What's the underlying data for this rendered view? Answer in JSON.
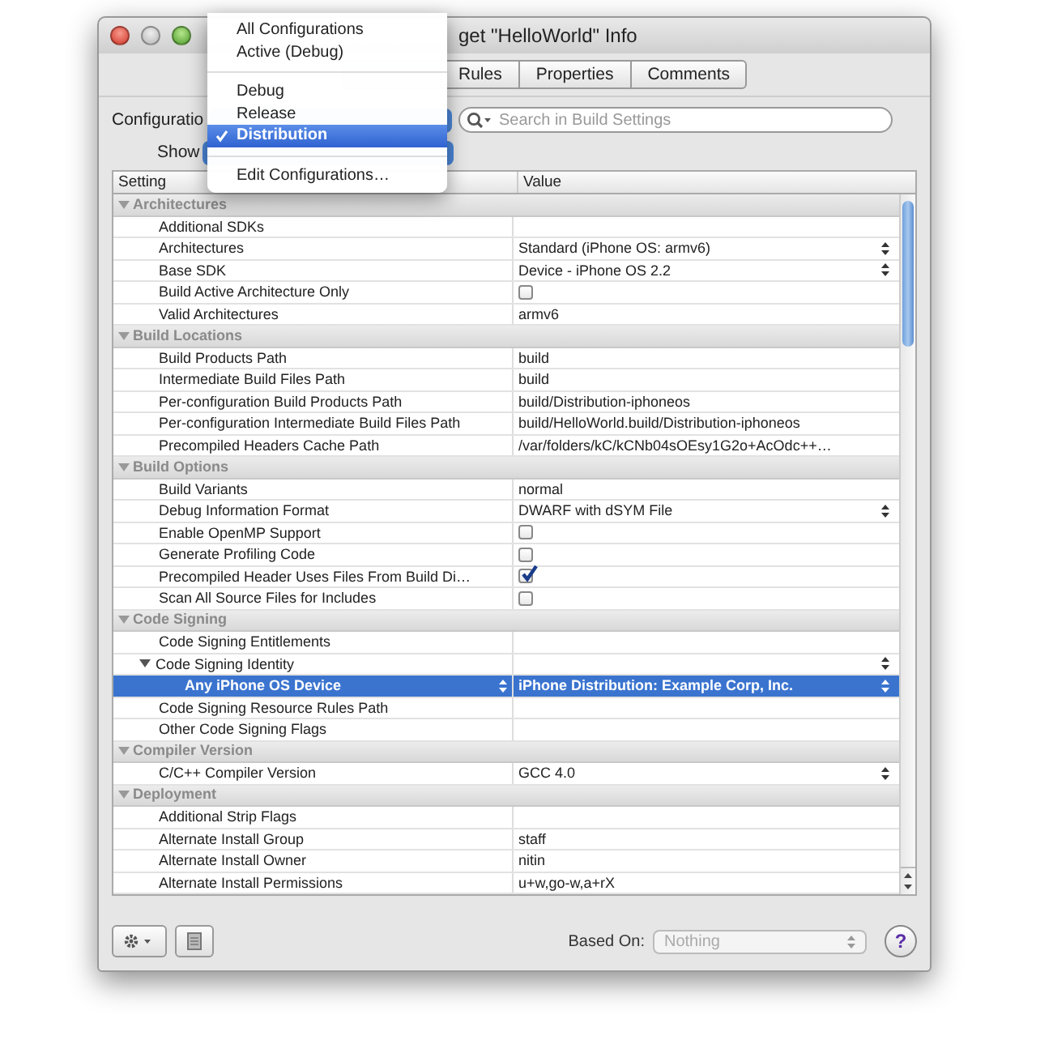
{
  "window": {
    "title": "get \"HelloWorld\" Info"
  },
  "tabs": [
    {
      "label": "Rules",
      "selected": false
    },
    {
      "label": "Properties",
      "selected": false
    },
    {
      "label": "Comments",
      "selected": false
    }
  ],
  "configuration": {
    "label": "Configuratio"
  },
  "show": {
    "label": "Show"
  },
  "search": {
    "placeholder": "Search in Build Settings"
  },
  "menu": {
    "sections": [
      [
        {
          "label": "All Configurations",
          "selected": false
        },
        {
          "label": "Active (Debug)",
          "selected": false
        }
      ],
      [
        {
          "label": "Debug",
          "selected": false
        },
        {
          "label": "Release",
          "selected": false
        },
        {
          "label": "Distribution",
          "selected": true
        }
      ],
      [
        {
          "label": "Edit Configurations…",
          "selected": false
        }
      ]
    ]
  },
  "table": {
    "columns": [
      "Setting",
      "Value"
    ],
    "groups": [
      {
        "label": "Architectures",
        "expanded": true,
        "children": [
          {
            "name": "Additional SDKs",
            "kind": "text",
            "selected": false
          },
          {
            "name": "Architectures",
            "kind": "popup",
            "value": "Standard (iPhone OS: armv6)",
            "selected": false
          },
          {
            "name": "Base SDK",
            "kind": "popup",
            "value": "Device - iPhone OS 2.2",
            "selected": false
          },
          {
            "name": "Build Active Architecture Only",
            "kind": "checkbox",
            "checked": false,
            "selected": false
          },
          {
            "name": "Valid Architectures",
            "kind": "text",
            "value": "armv6",
            "selected": false
          }
        ]
      },
      {
        "label": "Build Locations",
        "expanded": true,
        "children": [
          {
            "name": "Build Products Path",
            "kind": "text",
            "value": "build",
            "selected": false
          },
          {
            "name": "Intermediate Build Files Path",
            "kind": "text",
            "value": "build",
            "selected": false
          },
          {
            "name": "Per-configuration Build Products Path",
            "kind": "text",
            "value": "build/Distribution-iphoneos",
            "selected": false
          },
          {
            "name": "Per-configuration Intermediate Build Files Path",
            "kind": "text",
            "value": "build/HelloWorld.build/Distribution-iphoneos",
            "selected": false
          },
          {
            "name": "Precompiled Headers Cache Path",
            "kind": "text",
            "value": "/var/folders/kC/kCNb04sOEsy1G2o+AcOdc++…",
            "selected": false
          }
        ]
      },
      {
        "label": "Build Options",
        "expanded": true,
        "children": [
          {
            "name": "Build Variants",
            "kind": "text",
            "value": "normal",
            "selected": false
          },
          {
            "name": "Debug Information Format",
            "kind": "popup",
            "value": "DWARF with dSYM File",
            "selected": false
          },
          {
            "name": "Enable OpenMP Support",
            "kind": "checkbox",
            "checked": false,
            "selected": false
          },
          {
            "name": "Generate Profiling Code",
            "kind": "checkbox",
            "checked": false,
            "selected": false
          },
          {
            "name": "Precompiled Header Uses Files From Build Di…",
            "kind": "checkbox",
            "checked": true,
            "selected": false
          },
          {
            "name": "Scan All Source Files for Includes",
            "kind": "checkbox",
            "checked": false,
            "selected": false
          }
        ]
      },
      {
        "label": "Code Signing",
        "expanded": true,
        "children": [
          {
            "name": "Code Signing Entitlements",
            "kind": "text",
            "selected": false
          },
          {
            "name": "Code Signing Identity",
            "kind": "popup",
            "selected": false,
            "expanded": true,
            "children": [
              {
                "name": "Any iPhone OS Device",
                "kind": "popup",
                "name_popup": true,
                "value": "iPhone Distribution: Example Corp, Inc.",
                "selected": true
              }
            ]
          },
          {
            "name": "Code Signing Resource Rules Path",
            "kind": "text",
            "selected": false
          },
          {
            "name": "Other Code Signing Flags",
            "kind": "text",
            "selected": false
          }
        ]
      },
      {
        "label": "Compiler Version",
        "expanded": true,
        "children": [
          {
            "name": "C/C++ Compiler Version",
            "kind": "popup",
            "value": "GCC 4.0",
            "selected": false
          }
        ]
      },
      {
        "label": "Deployment",
        "expanded": true,
        "children": [
          {
            "name": "Additional Strip Flags",
            "kind": "text",
            "selected": false
          },
          {
            "name": "Alternate Install Group",
            "kind": "text",
            "value": "staff",
            "selected": false
          },
          {
            "name": "Alternate Install Owner",
            "kind": "text",
            "value": "nitin",
            "selected": false
          },
          {
            "name": "Alternate Install Permissions",
            "kind": "text",
            "value": "u+w,go-w,a+rX",
            "selected": false
          }
        ]
      }
    ]
  },
  "footer": {
    "based_on_label": "Based On:",
    "based_on_value": "Nothing",
    "based_on_disabled": true,
    "help_label": "?"
  }
}
